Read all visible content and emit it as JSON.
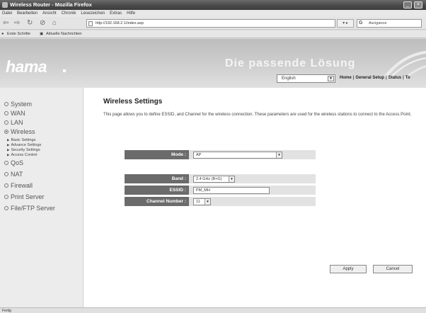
{
  "window": {
    "title": "Wireless Router - Mozilla Firefox"
  },
  "menu": [
    "Datei",
    "Bearbeiten",
    "Ansicht",
    "Chronik",
    "Lesezeichen",
    "Extras",
    "Hilfe"
  ],
  "navbar": {
    "url": "http://192.168.2.1/index.asp",
    "search_engine": "G",
    "search_value": "Ascigance"
  },
  "bookmarks": [
    "Erste Schritte",
    "Aktuelle Nachrichten"
  ],
  "header": {
    "logo": "hama",
    "slogan": "Die passende Lösung",
    "language": "English",
    "topnav": [
      "Home",
      "General Setup",
      "Status",
      "To"
    ]
  },
  "sidebar": {
    "items": [
      {
        "label": "System",
        "icon": "radio-empty"
      },
      {
        "label": "WAN",
        "icon": "radio-empty"
      },
      {
        "label": "LAN",
        "icon": "radio-empty"
      },
      {
        "label": "Wireless",
        "icon": "radio-checked"
      },
      {
        "label": "QoS",
        "icon": "radio-empty"
      },
      {
        "label": "NAT",
        "icon": "radio-empty"
      },
      {
        "label": "Firewall",
        "icon": "radio-empty"
      },
      {
        "label": "Print Server",
        "icon": "radio-empty"
      },
      {
        "label": "File/FTP Server",
        "icon": "radio-empty"
      }
    ],
    "wireless_sub": [
      "Basic Settings",
      "Advance Settings",
      "Security Settings",
      "Access Control"
    ]
  },
  "content": {
    "title": "Wireless Settings",
    "description": "This page allows you to define ESSID, and Channel for the wireless connection. These parameters are used for the wireless stations to connect to the Access Point.",
    "form": {
      "mode_label": "Mode :",
      "mode_value": "AP",
      "band_label": "Band :",
      "band_value": "2.4 GHz (B+G)",
      "essid_label": "ESSID :",
      "essid_value": "PM_MH",
      "channel_label": "Channel Number :",
      "channel_value": "11"
    },
    "apply_label": "Apply",
    "cancel_label": "Cancel"
  },
  "status_bar": "Fertig"
}
